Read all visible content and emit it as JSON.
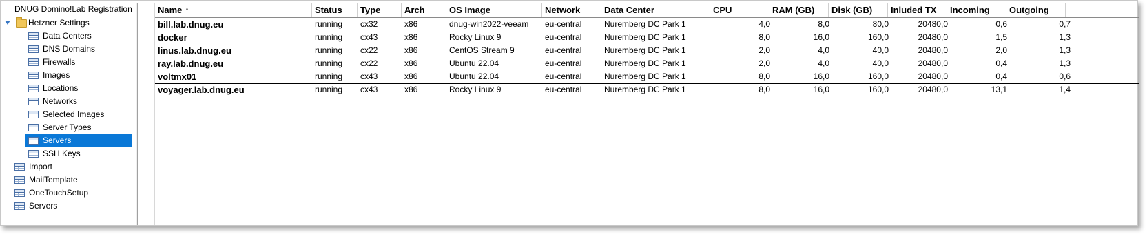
{
  "navigator": {
    "title": "DNUG Domino!Lab Registration",
    "items": [
      {
        "label": "Hetzner Settings",
        "type": "folder"
      },
      {
        "label": "Data Centers",
        "type": "view"
      },
      {
        "label": "DNS Domains",
        "type": "view"
      },
      {
        "label": "Firewalls",
        "type": "view"
      },
      {
        "label": "Images",
        "type": "view"
      },
      {
        "label": "Locations",
        "type": "view"
      },
      {
        "label": "Networks",
        "type": "view"
      },
      {
        "label": "Selected Images",
        "type": "view"
      },
      {
        "label": "Server Types",
        "type": "view"
      },
      {
        "label": "Servers",
        "type": "view",
        "selected": true
      },
      {
        "label": "SSH Keys",
        "type": "view"
      },
      {
        "label": "Import",
        "type": "view"
      },
      {
        "label": "MailTemplate",
        "type": "view"
      },
      {
        "label": "OneTouchSetup",
        "type": "view"
      },
      {
        "label": "Servers",
        "type": "view"
      }
    ]
  },
  "table": {
    "columns": [
      "Name",
      "Status",
      "Type",
      "Arch",
      "OS Image",
      "Network",
      "Data Center",
      "CPU",
      "RAM (GB)",
      "Disk (GB)",
      "Inluded TX",
      "Incoming",
      "Outgoing"
    ],
    "sorted_column": "Name",
    "rows": [
      [
        "bill.lab.dnug.eu",
        "running",
        "cx32",
        "x86",
        "dnug-win2022-veeam",
        "eu-central",
        "Nuremberg DC Park 1",
        "4,0",
        "8,0",
        "80,0",
        "20480,0",
        "0,6",
        "0,7"
      ],
      [
        "docker",
        "running",
        "cx43",
        "x86",
        "Rocky Linux 9",
        "eu-central",
        "Nuremberg DC Park 1",
        "8,0",
        "16,0",
        "160,0",
        "20480,0",
        "1,5",
        "1,3"
      ],
      [
        "linus.lab.dnug.eu",
        "running",
        "cx22",
        "x86",
        "CentOS Stream 9",
        "eu-central",
        "Nuremberg DC Park 1",
        "2,0",
        "4,0",
        "40,0",
        "20480,0",
        "2,0",
        "1,3"
      ],
      [
        "ray.lab.dnug.eu",
        "running",
        "cx22",
        "x86",
        "Ubuntu 22.04",
        "eu-central",
        "Nuremberg DC Park 1",
        "2,0",
        "4,0",
        "40,0",
        "20480,0",
        "0,4",
        "1,3"
      ],
      [
        "voltmx01",
        "running",
        "cx43",
        "x86",
        "Ubuntu 22.04",
        "eu-central",
        "Nuremberg DC Park 1",
        "8,0",
        "16,0",
        "160,0",
        "20480,0",
        "0,4",
        "0,6"
      ],
      [
        "voyager.lab.dnug.eu",
        "running",
        "cx43",
        "x86",
        "Rocky Linux 9",
        "eu-central",
        "Nuremberg DC Park 1",
        "8,0",
        "16,0",
        "160,0",
        "20480,0",
        "13,1",
        "1,4"
      ]
    ],
    "current_row": 5
  }
}
